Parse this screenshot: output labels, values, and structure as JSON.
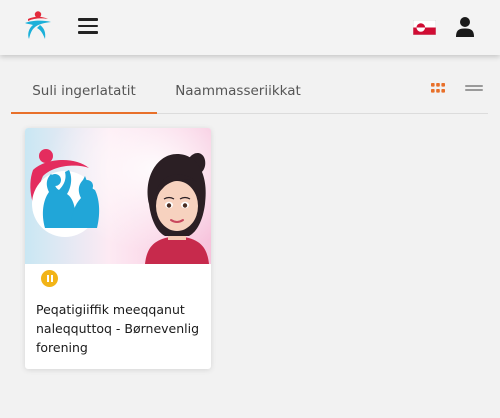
{
  "header": {
    "logo_icon": "organisation-logo",
    "menu_icon": "hamburger-menu-icon",
    "language_flag": "greenland-flag-icon",
    "user_icon": "user-account-icon"
  },
  "tabs": [
    {
      "label": "Suli ingerlatatit",
      "active": true
    },
    {
      "label": "Naammasseriikkat",
      "active": false
    }
  ],
  "view_toggle": {
    "grid_icon": "grid-view-icon",
    "list_icon": "list-view-icon",
    "accent": "#e8702a"
  },
  "courses": [
    {
      "title": "Peqatigiiffik meeqqanut naleqquttoq - Børnevenlig forening",
      "status_icon": "pause-icon",
      "status_color": "#f2b417"
    }
  ]
}
